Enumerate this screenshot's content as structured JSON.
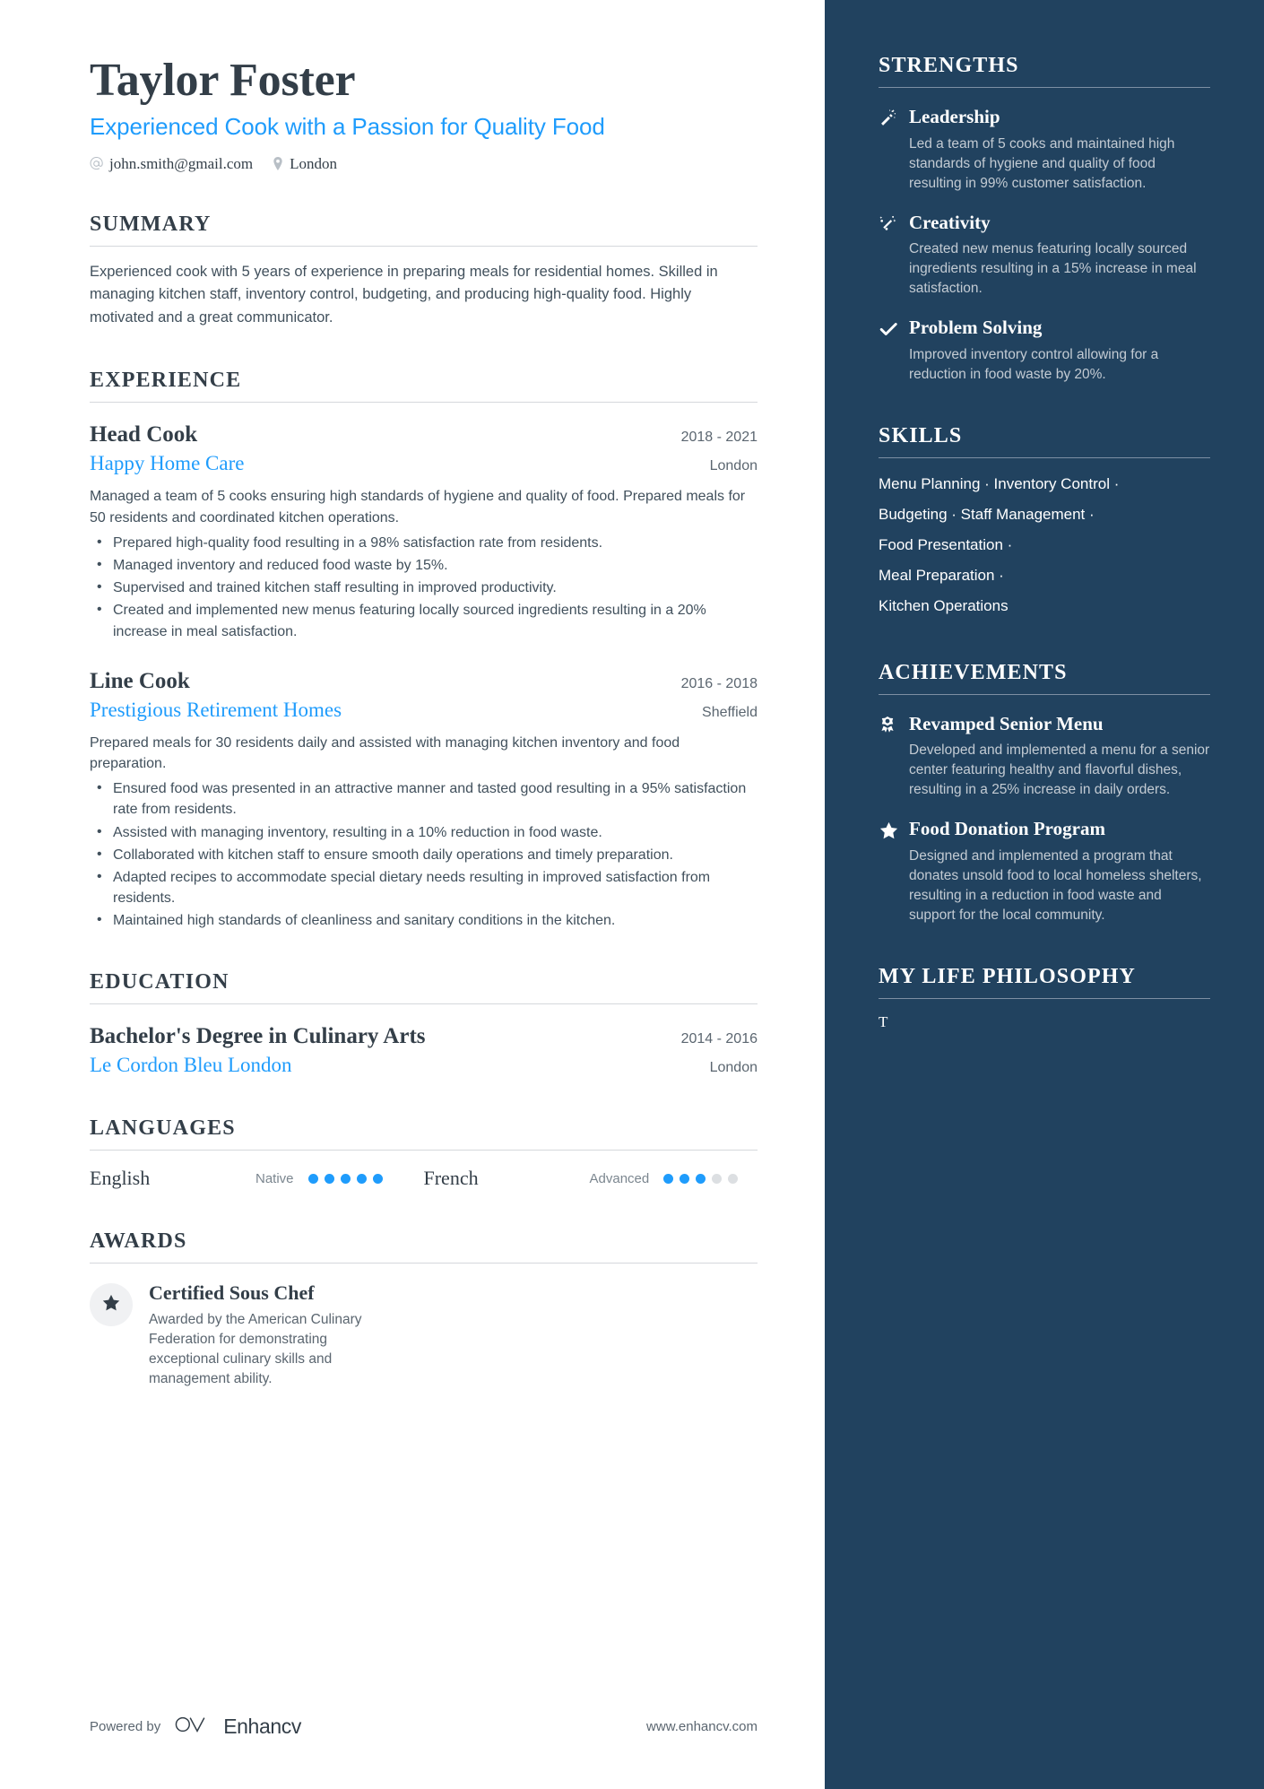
{
  "header": {
    "name": "Taylor Foster",
    "headline": "Experienced Cook with a Passion for Quality Food",
    "email": "john.smith@gmail.com",
    "location": "London"
  },
  "summary": {
    "title": "SUMMARY",
    "text": "Experienced cook with 5 years of experience in preparing meals for residential homes. Skilled in managing kitchen staff, inventory control, budgeting, and producing high-quality food. Highly motivated and a great communicator."
  },
  "experience": {
    "title": "EXPERIENCE",
    "entries": [
      {
        "role": "Head Cook",
        "dates": "2018 - 2021",
        "company": "Happy Home Care",
        "location": "London",
        "description": "Managed a team of 5 cooks ensuring high standards of hygiene and quality of food. Prepared meals for 50 residents and coordinated kitchen operations.",
        "bullets": [
          "Prepared high-quality food resulting in a 98% satisfaction rate from residents.",
          "Managed inventory and reduced food waste by 15%.",
          "Supervised and trained kitchen staff resulting in improved productivity.",
          "Created and implemented new menus featuring locally sourced ingredients resulting in a 20% increase in meal satisfaction."
        ]
      },
      {
        "role": "Line Cook",
        "dates": "2016 - 2018",
        "company": "Prestigious Retirement Homes",
        "location": "Sheffield",
        "description": "Prepared meals for 30 residents daily and assisted with managing kitchen inventory and food preparation.",
        "bullets": [
          "Ensured food was presented in an attractive manner and tasted good resulting in a 95% satisfaction rate from residents.",
          "Assisted with managing inventory, resulting in a 10% reduction in food waste.",
          "Collaborated with kitchen staff to ensure smooth daily operations and timely preparation.",
          "Adapted recipes to accommodate special dietary needs resulting in improved satisfaction from residents.",
          "Maintained high standards of cleanliness and sanitary conditions in the kitchen."
        ]
      }
    ]
  },
  "education": {
    "title": "EDUCATION",
    "entries": [
      {
        "degree": "Bachelor's Degree in Culinary Arts",
        "dates": "2014 - 2016",
        "school": "Le Cordon Bleu London",
        "location": "London"
      }
    ]
  },
  "languages": {
    "title": "LANGUAGES",
    "items": [
      {
        "name": "English",
        "level": "Native",
        "filled": 5,
        "total": 5
      },
      {
        "name": "French",
        "level": "Advanced",
        "filled": 3,
        "total": 5
      }
    ]
  },
  "awards": {
    "title": "AWARDS",
    "items": [
      {
        "name": "Certified Sous Chef",
        "description": "Awarded by the American Culinary Federation for demonstrating exceptional culinary skills and management ability."
      }
    ]
  },
  "footer": {
    "powered_by": "Powered by",
    "brand": "Enhancv",
    "website": "www.enhancv.com"
  },
  "sidebar": {
    "strengths": {
      "title": "STRENGTHS",
      "items": [
        {
          "icon": "magic-wand-icon",
          "title": "Leadership",
          "description": "Led a team of 5 cooks and maintained high standards of hygiene and quality of food resulting in 99% customer satisfaction."
        },
        {
          "icon": "sparkle-icon",
          "title": "Creativity",
          "description": "Created new menus featuring locally sourced ingredients resulting in a 15% increase in meal satisfaction."
        },
        {
          "icon": "check-icon",
          "title": "Problem Solving",
          "description": "Improved inventory control allowing for a reduction in food waste by 20%."
        }
      ]
    },
    "skills": {
      "title": "SKILLS",
      "items": [
        "Menu Planning",
        "Inventory Control",
        "Budgeting",
        "Staff Management",
        "Food Presentation",
        "Meal Preparation",
        "Kitchen Operations"
      ],
      "separator": "·",
      "line1": "Menu Planning · Inventory Control ·",
      "line2": "Budgeting · Staff Management ·",
      "line3": "Food Presentation ·",
      "line4": "Meal Preparation ·",
      "line5": "Kitchen Operations"
    },
    "achievements": {
      "title": "ACHIEVEMENTS",
      "items": [
        {
          "icon": "award-ribbon-icon",
          "title": "Revamped Senior Menu",
          "description": "Developed and implemented a menu for a senior center featuring healthy and flavorful dishes, resulting in a 25% increase in daily orders."
        },
        {
          "icon": "star-icon",
          "title": "Food Donation Program",
          "description": "Designed and implemented a program that donates unsold food to local homeless shelters, resulting in a reduction in food waste and support for the local community."
        }
      ]
    },
    "philosophy": {
      "title": "MY LIFE PHILOSOPHY",
      "text": "T"
    }
  },
  "colors": {
    "accent": "#1f9cfc",
    "sidebar_bg": "#21425f",
    "text": "#333e48",
    "muted": "#5b6670"
  }
}
